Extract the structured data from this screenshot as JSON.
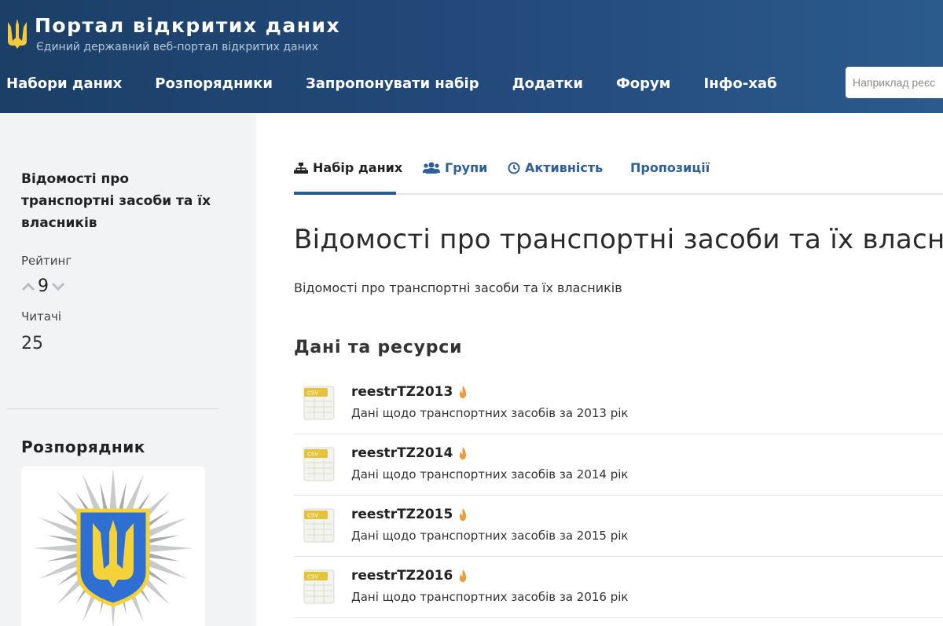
{
  "header": {
    "title": "Портал відкритих даних",
    "subtitle": "Єдиний державний веб-портал відкритих даних",
    "nav": [
      "Набори даних",
      "Розпорядники",
      "Запропонувати набір",
      "Додатки",
      "Форум",
      "Інфо-хаб"
    ],
    "search_placeholder": "Наприклад реєс"
  },
  "sidebar": {
    "dataset_title": "Відомості про транспортні засоби та їх власників",
    "rating_label": "Рейтинг",
    "rating_value": "9",
    "readers_label": "Читачі",
    "readers_value": "25",
    "organization_heading": "Розпорядник"
  },
  "tabs": [
    "Набір даних",
    "Групи",
    "Активність",
    "Пропозиції"
  ],
  "main": {
    "title": "Відомості про транспортні засоби та їх власників",
    "description": "Відомості про транспортні засоби та їх власників",
    "resources_heading": "Дані та ресурси",
    "resources": [
      {
        "name": "reestrTZ2013",
        "desc": "Дані щодо транспортних засобів за 2013 рік",
        "format": "CSV"
      },
      {
        "name": "reestrTZ2014",
        "desc": "Дані щодо транспортних засобів за 2014 рік",
        "format": "CSV"
      },
      {
        "name": "reestrTZ2015",
        "desc": "Дані щодо транспортних засобів за 2015 рік",
        "format": "CSV"
      },
      {
        "name": "reestrTZ2016",
        "desc": "Дані щодо транспортних засобів за 2016 рік",
        "format": "CSV"
      }
    ]
  },
  "colors": {
    "header_bg": "#23497a",
    "accent": "#2b5a8c",
    "trident_gold": "#f3c940",
    "csv_badge": "#e4c23a"
  },
  "icons": [
    "trident-icon",
    "sitemap-icon",
    "users-icon",
    "clock-icon",
    "chevron-up-icon",
    "chevron-down-icon",
    "csv-file-icon",
    "flame-icon"
  ]
}
